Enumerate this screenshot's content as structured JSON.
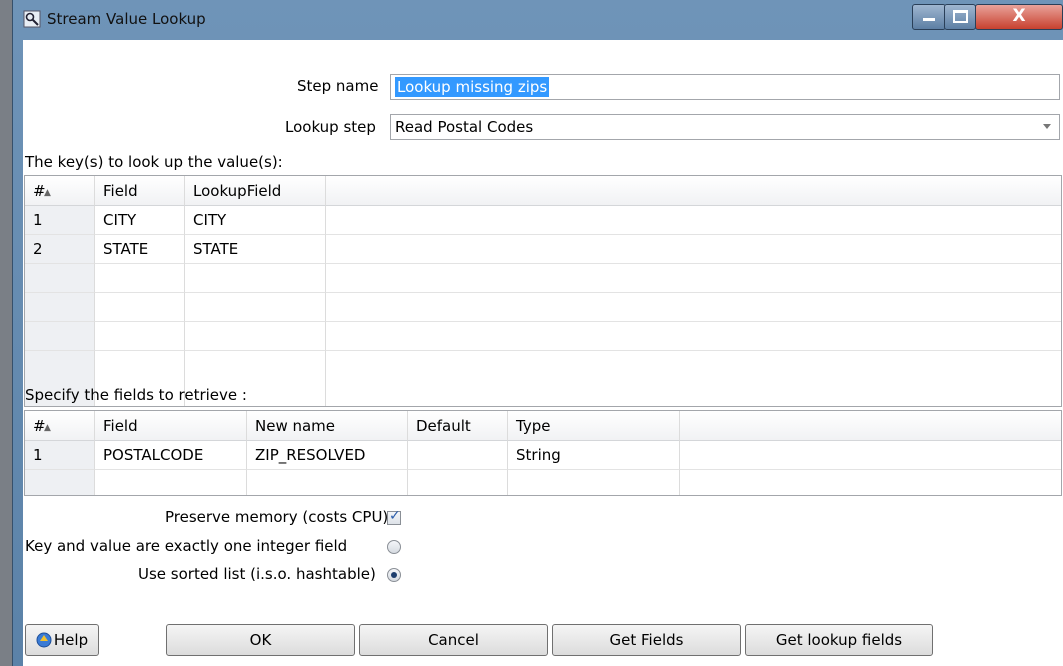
{
  "window": {
    "title": "Stream Value Lookup",
    "close_glyph": "X"
  },
  "form": {
    "step_name_label": "Step name",
    "step_name_value": "Lookup missing zips",
    "lookup_step_label": "Lookup step",
    "lookup_step_value": "Read Postal Codes"
  },
  "keys_section": {
    "label": "The key(s) to look up the value(s):",
    "headers": [
      "#",
      "Field",
      "LookupField"
    ],
    "rows": [
      [
        "1",
        "CITY",
        "CITY"
      ],
      [
        "2",
        "STATE",
        "STATE"
      ]
    ]
  },
  "retrieve_section": {
    "label": "Specify the fields to retrieve :",
    "headers": [
      "#",
      "Field",
      "New name",
      "Default",
      "Type"
    ],
    "rows": [
      [
        "1",
        "POSTALCODE",
        "ZIP_RESOLVED",
        "",
        "String"
      ]
    ]
  },
  "options": {
    "preserve_memory": {
      "label": "Preserve memory (costs CPU)",
      "checked": true
    },
    "one_integer": {
      "label": "Key and value are exactly one integer field",
      "selected": false
    },
    "sorted_list": {
      "label": "Use sorted list (i.s.o. hashtable)",
      "selected": true
    }
  },
  "buttons": {
    "help": "Help",
    "ok": "OK",
    "cancel": "Cancel",
    "get_fields": "Get Fields",
    "get_lookup_fields": "Get lookup fields"
  },
  "icons": {
    "app": "stream-lookup-icon",
    "help": "help-icon"
  }
}
